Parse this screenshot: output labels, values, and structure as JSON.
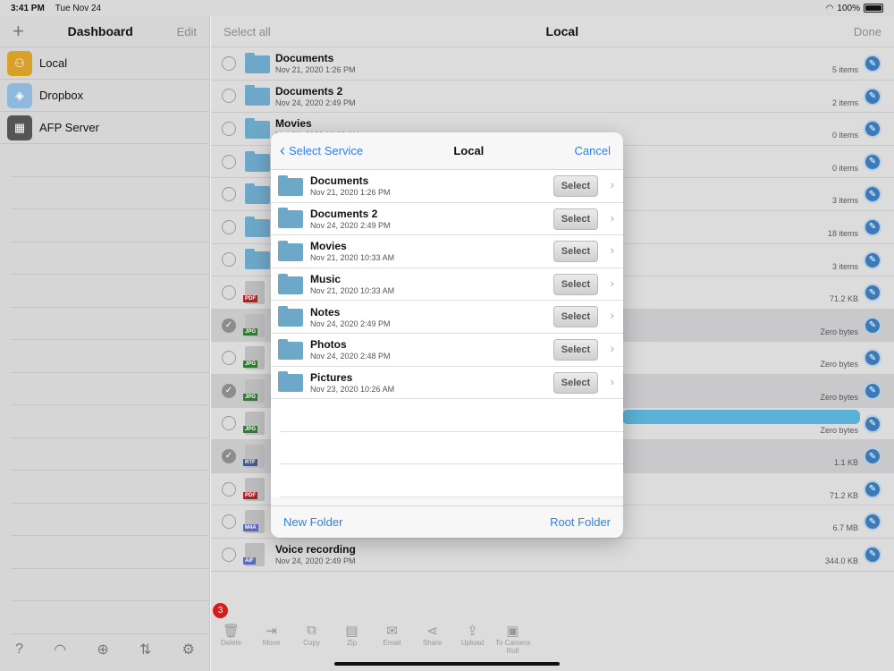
{
  "status": {
    "time": "3:41 PM",
    "date": "Tue Nov 24",
    "battery": "100%"
  },
  "sidebar": {
    "title": "Dashboard",
    "edit_label": "Edit",
    "add_icon": "plus-icon",
    "items": [
      {
        "label": "Local",
        "icon": "local-people-icon",
        "color": "#d8a22a"
      },
      {
        "label": "Dropbox",
        "icon": "dropbox-icon",
        "color": "#8fb8dd"
      },
      {
        "label": "AFP Server",
        "icon": "server-network-icon",
        "color": "#555555"
      }
    ],
    "footer_icons": [
      "help-icon",
      "wifi-icon",
      "globe-icon",
      "transfer-icon",
      "gear-icon"
    ]
  },
  "main": {
    "select_all": "Select all",
    "title": "Local",
    "done": "Done",
    "files": [
      {
        "name": "Documents",
        "date": "Nov 21, 2020 1:26 PM",
        "size": "5 items",
        "type": "folder",
        "checked": false
      },
      {
        "name": "Documents 2",
        "date": "Nov 24, 2020 2:49 PM",
        "size": "2 items",
        "type": "folder",
        "checked": false
      },
      {
        "name": "Movies",
        "date": "Nov 21, 2020 10:33 AM",
        "size": "0 items",
        "type": "folder",
        "checked": false
      },
      {
        "name": "",
        "date": "",
        "size": "0 items",
        "type": "folder",
        "checked": false
      },
      {
        "name": "",
        "date": "",
        "size": "3 items",
        "type": "folder",
        "checked": false
      },
      {
        "name": "",
        "date": "",
        "size": "18 items",
        "type": "folder",
        "checked": false
      },
      {
        "name": "",
        "date": "",
        "size": "3 items",
        "type": "folder",
        "checked": false
      },
      {
        "name": "",
        "date": "",
        "size": "71.2 KB",
        "type": "PDF",
        "checked": false
      },
      {
        "name": "",
        "date": "",
        "size": "Zero bytes",
        "type": "JPG",
        "checked": true
      },
      {
        "name": "",
        "date": "",
        "size": "Zero bytes",
        "type": "JPG",
        "checked": false
      },
      {
        "name": "",
        "date": "",
        "size": "Zero bytes",
        "type": "JPG",
        "checked": true
      },
      {
        "name": "",
        "date": "",
        "size": "Zero bytes",
        "type": "JPG",
        "checked": false
      },
      {
        "name": "",
        "date": "",
        "size": "1.1 KB",
        "type": "RTF",
        "checked": true
      },
      {
        "name": "",
        "date": "",
        "size": "71.2 KB",
        "type": "PDF",
        "checked": false
      },
      {
        "name": "",
        "date": "",
        "size": "6.7 MB",
        "type": "M4A",
        "checked": false
      },
      {
        "name": "Voice recording",
        "date": "Nov 24, 2020 2:49 PM",
        "size": "344.0 KB",
        "type": "AIF",
        "checked": false
      }
    ],
    "type_colors": {
      "PDF": "#b22222",
      "JPG": "#2e7d32",
      "RTF": "#455a8a",
      "M4A": "#5b6ab8",
      "AIF": "#5b6ab8"
    }
  },
  "toolbar": {
    "badge": "3",
    "items": [
      {
        "label": "Delete",
        "icon": "trash-icon",
        "glyph": "🗑"
      },
      {
        "label": "Move",
        "icon": "move-icon",
        "glyph": "⇥"
      },
      {
        "label": "Copy",
        "icon": "copy-icon",
        "glyph": "⧉"
      },
      {
        "label": "Zip",
        "icon": "zip-icon",
        "glyph": "▤"
      },
      {
        "label": "Email",
        "icon": "email-icon",
        "glyph": "✉"
      },
      {
        "label": "Share",
        "icon": "share-icon",
        "glyph": "⋖"
      },
      {
        "label": "Upload",
        "icon": "upload-icon",
        "glyph": "⇪"
      },
      {
        "label": "To Camera Roll",
        "icon": "camera-roll-icon",
        "glyph": "▣"
      }
    ]
  },
  "modal": {
    "back_label": "Select Service",
    "title": "Local",
    "cancel_label": "Cancel",
    "select_label": "Select",
    "rows": [
      {
        "name": "Documents",
        "date": "Nov 21, 2020 1:26 PM"
      },
      {
        "name": "Documents 2",
        "date": "Nov 24, 2020 2:49 PM"
      },
      {
        "name": "Movies",
        "date": "Nov 21, 2020 10:33 AM"
      },
      {
        "name": "Music",
        "date": "Nov 21, 2020 10:33 AM"
      },
      {
        "name": "Notes",
        "date": "Nov 24, 2020 2:49 PM"
      },
      {
        "name": "Photos",
        "date": "Nov 24, 2020 2:48 PM"
      },
      {
        "name": "Pictures",
        "date": "Nov 23, 2020 10:26 AM"
      }
    ],
    "new_folder": "New Folder",
    "root_folder": "Root Folder"
  }
}
